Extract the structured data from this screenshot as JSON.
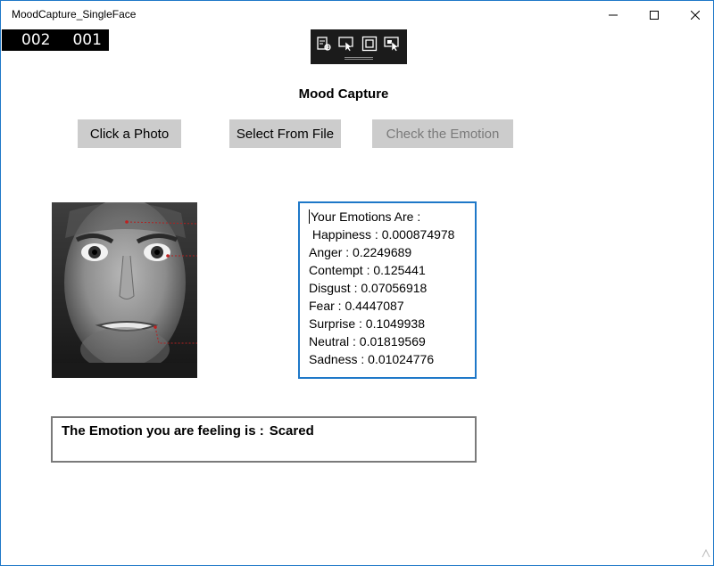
{
  "window": {
    "title": "MoodCapture_SingleFace",
    "controls": {
      "minimize": "minimize-icon",
      "maximize": "maximize-icon",
      "close": "close-icon"
    }
  },
  "frame_counter": {
    "value1": "002",
    "value2": "001"
  },
  "dev_toolbar": {
    "icons": [
      "live-visual-tree-icon",
      "select-element-icon",
      "display-layout-adorners-icon",
      "track-focus-icon"
    ]
  },
  "app": {
    "heading": "Mood Capture",
    "buttons": {
      "photo": "Click a Photo",
      "file": "Select From File",
      "check": "Check the Emotion"
    },
    "results": {
      "title": "Your Emotions Are :",
      "lines": [
        " Happiness : 0.000874978",
        "Anger : 0.2249689",
        "Contempt : 0.125441",
        "Disgust : 0.07056918",
        "Fear : 0.4447087",
        "Surprise : 0.1049938",
        "Neutral : 0.01819569",
        "Sadness : 0.01024776"
      ]
    },
    "verdict": {
      "label": "The Emotion you are feeling is :",
      "value": "Scared"
    }
  },
  "colors": {
    "accent": "#1e78c8",
    "button_bg": "#cccccc",
    "disabled_text": "#7a7a7a",
    "verdict_border": "#7a7a7a"
  }
}
